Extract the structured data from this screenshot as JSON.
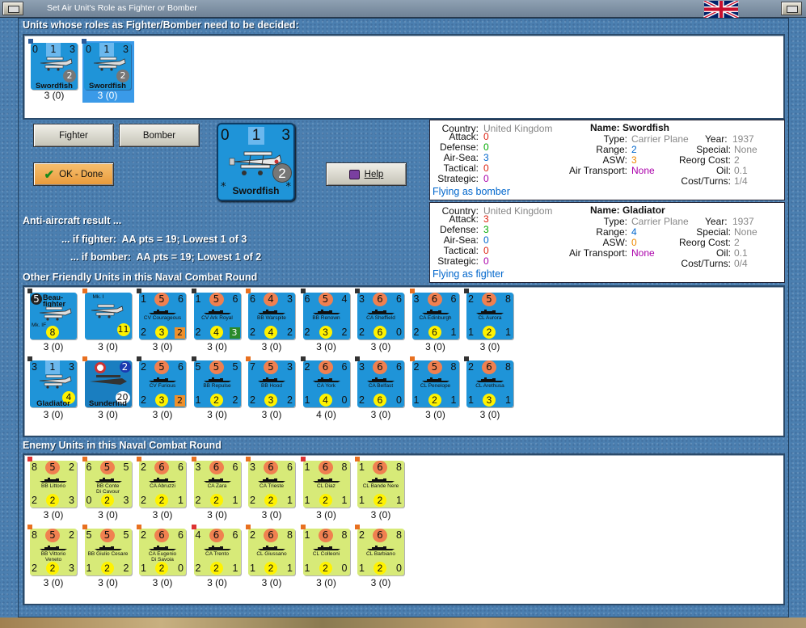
{
  "window": {
    "title": "Set Air Unit's Role as Fighter or Bomber"
  },
  "headers": {
    "undecided": "Units whose roles as Fighter/Bomber need to be decided:",
    "friendly": "Other Friendly Units in this Naval Combat Round",
    "enemy": "Enemy Units in this Naval Combat Round"
  },
  "undecided": [
    {
      "tl": "0",
      "mid": "1",
      "tr": "3",
      "name": "Swordfish",
      "circle": "2",
      "count": "3 (0)",
      "selected": false
    },
    {
      "tl": "0",
      "mid": "1",
      "tr": "3",
      "name": "Swordfish",
      "circle": "2",
      "count": "3 (0)",
      "selected": true
    }
  ],
  "buttons": {
    "fighter": "Fighter",
    "bomber": "Bomber",
    "ok": "OK - Done",
    "help": "Help"
  },
  "big_unit": {
    "tl": "0",
    "mid": "1",
    "tr": "3",
    "name": "Swordfish",
    "circle": "2"
  },
  "aa": {
    "title": "Anti-aircraft result ...",
    "fighter": "... if fighter:  AA pts = 19; Lowest 1 of 3",
    "bomber": "... if bomber:  AA pts = 19; Lowest 1 of 2"
  },
  "info": [
    {
      "country": "United Kingdom",
      "name": "Name: Swordfish",
      "attack": "0",
      "type": "Carrier Plane",
      "year_label": "Year:",
      "year": "1937",
      "defense": "0",
      "range": "2",
      "special": "None",
      "airsea": "3",
      "asw": "3",
      "reorg": "2",
      "tactical": "0",
      "airtransport": "None",
      "oil": "0.1",
      "strategic": "0",
      "costturns": "1/4",
      "flying": "Flying as bomber"
    },
    {
      "country": "United Kingdom",
      "name": "Name: Gladiator",
      "attack": "3",
      "type": "Carrier Plane",
      "year_label": "Year:",
      "year": "1937",
      "defense": "3",
      "range": "4",
      "special": "None",
      "airsea": "0",
      "asw": "0",
      "reorg": "2",
      "tactical": "0",
      "airtransport": "None",
      "oil": "0.1",
      "strategic": "0",
      "costturns": "0/4",
      "flying": "Flying as fighter"
    }
  ],
  "labels": {
    "country": "Country:",
    "attack": "Attack:",
    "defense": "Defense:",
    "airsea": "Air-Sea:",
    "tactical": "Tactical:",
    "strategic": "Strategic:",
    "type": "Type:",
    "range": "Range:",
    "asw": "ASW:",
    "airtransport": "Air Transport:",
    "special": "Special:",
    "reorg": "Reorg Cost:",
    "oil": "Oil:",
    "costturns": "Cost/Turns:"
  },
  "friendly_units": [
    {
      "kind": "plane",
      "tl": "5",
      "label": "Beau-\nfighter",
      "sub": "Mk. IF",
      "bm": "8",
      "count": "3 (0)",
      "mid_style": "black"
    },
    {
      "kind": "plane2",
      "label": "Beaufort",
      "sub": "Mk. I",
      "yb": "11",
      "count": "3 (0)"
    },
    {
      "kind": "ship",
      "tl": "1",
      "mid": "5",
      "tr": "6",
      "name": "CV Courageous",
      "bl": "2",
      "bm": "3",
      "sq": "2",
      "sqc": "or",
      "count": "3 (0)"
    },
    {
      "kind": "ship",
      "tl": "1",
      "mid": "5",
      "tr": "6",
      "name": "CV Ark Royal",
      "bl": "2",
      "bm": "4",
      "sq": "3",
      "sqc": "gr",
      "count": "3 (0)"
    },
    {
      "kind": "ship",
      "tl": "6",
      "mid": "4",
      "tr": "3",
      "name": "BB Warspite",
      "bl": "2",
      "bm": "4",
      "br": "2",
      "count": "3 (0)"
    },
    {
      "kind": "ship",
      "tl": "6",
      "mid": "5",
      "tr": "4",
      "name": "BB Renown",
      "bl": "2",
      "bm": "3",
      "br": "2",
      "count": "3 (0)"
    },
    {
      "kind": "ship",
      "tl": "3",
      "mid": "6",
      "tr": "6",
      "name": "CA Sheffield",
      "bl": "2",
      "bm": "6",
      "br": "0",
      "count": "3 (0)"
    },
    {
      "kind": "ship",
      "tl": "3",
      "mid": "6",
      "tr": "6",
      "name": "CA Edinburgh",
      "bl": "2",
      "bm": "6",
      "br": "1",
      "count": "3 (0)"
    },
    {
      "kind": "ship",
      "tl": "2",
      "mid": "5",
      "tr": "8",
      "name": "CL Aurora",
      "bl": "1",
      "bm": "2",
      "br": "1",
      "count": "3 (0)"
    },
    {
      "kind": "plane3",
      "tl": "3",
      "mid": "1",
      "tr": "3",
      "name": "Gladiator",
      "yb": "4",
      "count": "3 (0)"
    },
    {
      "kind": "plane4",
      "name": "SunderInd",
      "tr": "2",
      "bm2": "20",
      "count": "3 (0)"
    },
    {
      "kind": "ship",
      "tl": "2",
      "mid": "5",
      "tr": "6",
      "name": "CV Furious",
      "bl": "2",
      "bm": "3",
      "sq": "2",
      "sqc": "or",
      "count": "3 (0)"
    },
    {
      "kind": "ship",
      "tl": "5",
      "mid": "5",
      "tr": "5",
      "name": "BB Repulse",
      "bl": "1",
      "bm": "2",
      "br": "2",
      "count": "3 (0)"
    },
    {
      "kind": "ship",
      "tl": "7",
      "mid": "5",
      "tr": "3",
      "name": "BB Hood",
      "bl": "2",
      "bm": "3",
      "br": "2",
      "count": "3 (0)"
    },
    {
      "kind": "ship",
      "tl": "2",
      "mid": "6",
      "tr": "6",
      "name": "CA York",
      "bl": "1",
      "bm": "4",
      "br": "0",
      "count": "4 (0)"
    },
    {
      "kind": "ship",
      "tl": "3",
      "mid": "6",
      "tr": "6",
      "name": "CA Belfast",
      "bl": "2",
      "bm": "6",
      "br": "0",
      "count": "3 (0)"
    },
    {
      "kind": "ship",
      "tl": "2",
      "mid": "5",
      "tr": "8",
      "name": "CL Penelope",
      "bl": "1",
      "bm": "2",
      "br": "1",
      "count": "3 (0)"
    },
    {
      "kind": "ship",
      "tl": "2",
      "mid": "6",
      "tr": "8",
      "name": "CL Arethusa",
      "bl": "1",
      "bm": "3",
      "br": "1",
      "count": "3 (0)"
    }
  ],
  "enemy_units": [
    {
      "tl": "8",
      "mid": "5",
      "tr": "2",
      "name": "BB Littorio",
      "bl": "2",
      "bm": "2",
      "br": "3",
      "count": "3 (0)"
    },
    {
      "tl": "6",
      "mid": "5",
      "tr": "5",
      "name": "BB Conte\nDi Cavour",
      "bl": "0",
      "bm": "2",
      "br": "3",
      "count": "3 (0)"
    },
    {
      "tl": "2",
      "mid": "6",
      "tr": "6",
      "name": "CA Abruzzi",
      "bl": "2",
      "bm": "2",
      "br": "1",
      "count": "3 (0)"
    },
    {
      "tl": "3",
      "mid": "6",
      "tr": "6",
      "name": "CA Zara",
      "bl": "2",
      "bm": "2",
      "br": "1",
      "count": "3 (0)"
    },
    {
      "tl": "3",
      "mid": "6",
      "tr": "6",
      "name": "CA Trieste",
      "bl": "2",
      "bm": "2",
      "br": "1",
      "count": "3 (0)"
    },
    {
      "tl": "1",
      "mid": "6",
      "tr": "8",
      "name": "CL Diaz",
      "bl": "1",
      "bm": "2",
      "br": "1",
      "count": "3 (0)"
    },
    {
      "tl": "1",
      "mid": "6",
      "tr": "8",
      "name": "CL Bande Nere",
      "bl": "1",
      "bm": "2",
      "br": "1",
      "count": "3 (0)"
    },
    {
      "tl": "8",
      "mid": "5",
      "tr": "2",
      "name": "BB Vittorio\nVeneto",
      "bl": "2",
      "bm": "2",
      "br": "3",
      "count": "3 (0)"
    },
    {
      "tl": "5",
      "mid": "5",
      "tr": "5",
      "name": "BB Giulio Cesare",
      "bl": "1",
      "bm": "2",
      "br": "2",
      "count": "3 (0)"
    },
    {
      "tl": "2",
      "mid": "6",
      "tr": "6",
      "name": "CA Eugenio\nDi Savoia",
      "bl": "1",
      "bm": "2",
      "br": "0",
      "count": "3 (0)"
    },
    {
      "tl": "4",
      "mid": "6",
      "tr": "6",
      "name": "CA Trento",
      "bl": "2",
      "bm": "2",
      "br": "1",
      "count": "3 (0)"
    },
    {
      "tl": "2",
      "mid": "6",
      "tr": "8",
      "name": "CL Giussano",
      "bl": "1",
      "bm": "2",
      "br": "1",
      "count": "3 (0)"
    },
    {
      "tl": "1",
      "mid": "6",
      "tr": "8",
      "name": "CL Colleoni",
      "bl": "1",
      "bm": "2",
      "br": "0",
      "count": "3 (0)"
    },
    {
      "tl": "2",
      "mid": "6",
      "tr": "8",
      "name": "CL Barbiano",
      "bl": "1",
      "bm": "2",
      "br": "0",
      "count": "3 (0)"
    }
  ]
}
